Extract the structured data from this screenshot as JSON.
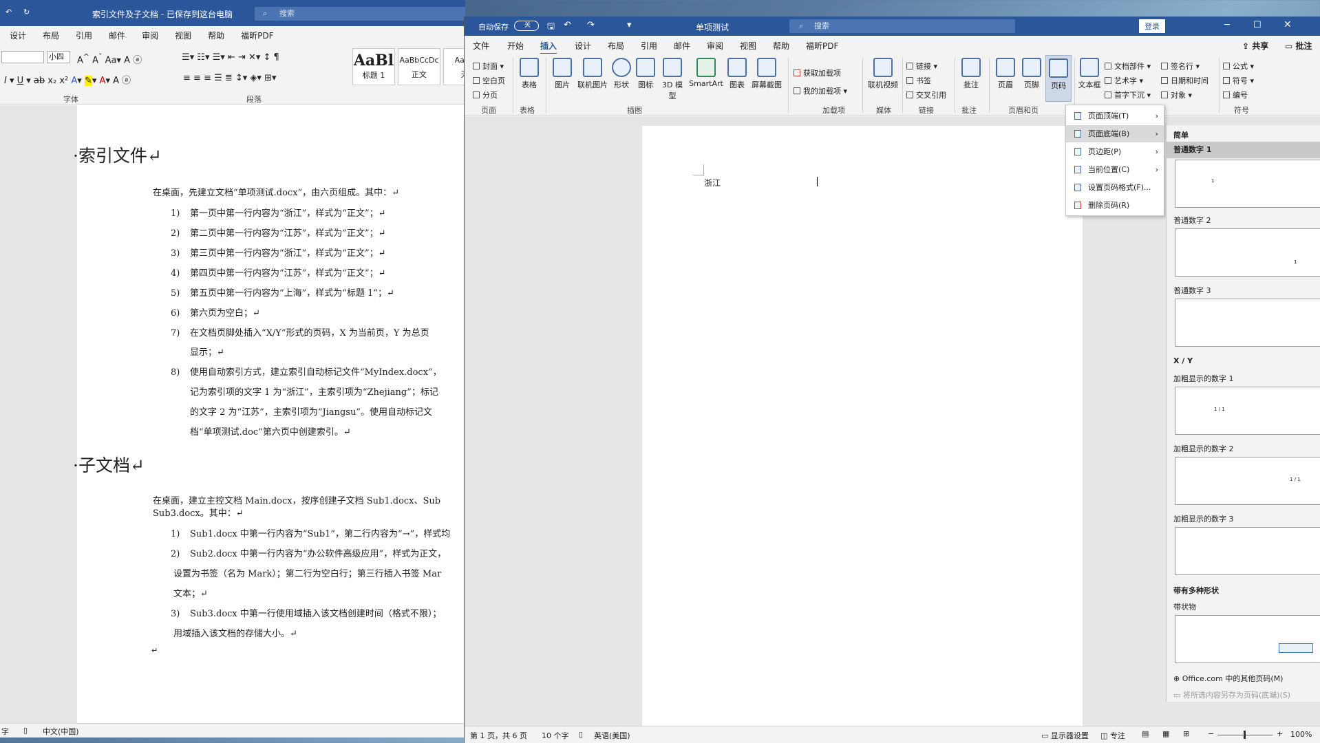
{
  "back_window": {
    "title": "索引文件及子文档 - 已保存到这台电脑",
    "search_placeholder": "搜索",
    "tabs": [
      "设计",
      "布局",
      "引用",
      "邮件",
      "审阅",
      "视图",
      "帮助",
      "福昕PDF"
    ],
    "font_size": "小四",
    "styles": [
      {
        "preview": "AaBl",
        "label": "标题 1"
      },
      {
        "preview": "AaBbCcDc",
        "label": "正文"
      },
      {
        "preview": "AaBb",
        "label": "无"
      }
    ],
    "groups": {
      "font": "字体",
      "paragraph": "段落"
    },
    "document": {
      "heading1": "索引文件",
      "intro": "在桌面，先建立文档“单项测试.docx”，由六页组成。其中：",
      "items": [
        {
          "n": "1)",
          "text": "第一页中第一行内容为“浙江”，样式为“正文”；"
        },
        {
          "n": "2)",
          "text": "第二页中第一行内容为“江苏”，样式为“正文”；"
        },
        {
          "n": "3)",
          "text": "第三页中第一行内容为“浙江”，样式为“正文”；"
        },
        {
          "n": "4)",
          "text": "第四页中第一行内容为“江苏”，样式为“正文”；"
        },
        {
          "n": "5)",
          "text": "第五页中第一行内容为“上海”，样式为“标题 1”；"
        },
        {
          "n": "6)",
          "text": "第六页为空白；"
        },
        {
          "n": "7)",
          "text": "在文档页脚处插入“X/Y”形式的页码，X 为当前页，Y 为总页"
        },
        {
          "n": "8)",
          "text": "使用自动索引方式，建立索引自动标记文件“MyIndex.docx”，"
        }
      ],
      "item7_cont": "显示；",
      "item8_cont": [
        "记为索引项的文字 1 为“浙江”，主索引项为“Zhejiang”；标记",
        "的文字 2 为“江苏”，主索引项为“Jiangsu”。使用自动标记文",
        "档“单项测试.doc”第六页中创建索引。"
      ],
      "heading2": "子文档",
      "intro2": [
        "在桌面，建立主控文档 Main.docx，按序创建子文档 Sub1.docx、Sub",
        "Sub3.docx。其中："
      ],
      "sub_items": [
        {
          "n": "1)",
          "text": "Sub1.docx 中第一行内容为“Sub1”，第二行内容为“→”，样式均"
        },
        {
          "n": "2)",
          "text": "Sub2.docx 中第一行内容为“办公软件高级应用”，样式为正文，"
        },
        {
          "n": "3)",
          "text": "Sub3.docx 中第一行使用域插入该文档创建时间（格式不限）；"
        }
      ],
      "sub2_cont": [
        "设置为书签（名为 Mark）；第二行为空白行；第三行插入书签 Mar",
        "文本；"
      ],
      "sub3_cont": "用域插入该文档的存储大小。"
    },
    "status": {
      "words": "字",
      "lang": "中文(中国)"
    }
  },
  "front_window": {
    "autosave": "自动保存",
    "toggle": "关",
    "title": "单项测试",
    "search_placeholder": "搜索",
    "login": "登录",
    "tabs": [
      "文件",
      "开始",
      "插入",
      "设计",
      "布局",
      "引用",
      "邮件",
      "审阅",
      "视图",
      "帮助",
      "福昕PDF"
    ],
    "active_tab": "插入",
    "share": "共享",
    "comments": "批注",
    "ribbon": {
      "page_group": {
        "items": [
          "封面",
          "空白页",
          "分页"
        ],
        "label": "页面"
      },
      "table": {
        "label": "表格",
        "group": "表格"
      },
      "illustrations": {
        "items": [
          "图片",
          "联机图片",
          "形状",
          "图标",
          "3D 模型",
          "SmartArt",
          "图表",
          "屏幕截图"
        ],
        "label": "插图"
      },
      "addins": {
        "items": [
          "获取加载项",
          "我的加载项"
        ],
        "label": "加载项"
      },
      "media": {
        "item": "联机视频",
        "label": "媒体"
      },
      "links": {
        "items": [
          "链接",
          "书签",
          "交叉引用"
        ],
        "label": "链接"
      },
      "comment": {
        "item": "批注",
        "label": "批注"
      },
      "header_footer": {
        "items": [
          "页眉",
          "页脚",
          "页码"
        ],
        "label": "页眉和页"
      },
      "text": {
        "items": [
          "文本框"
        ],
        "side": [
          "文档部件",
          "艺术字",
          "首字下沉"
        ],
        "side2": [
          "签名行",
          "日期和时间",
          "对象"
        ],
        "label": "文本"
      },
      "symbols": {
        "items": [
          "公式",
          "符号",
          "编号"
        ],
        "label": "符号"
      }
    },
    "page_text": "浙江",
    "status": {
      "page": "第 1 页，共 6 页",
      "words": "10 个字",
      "lang": "英语(美国)",
      "display": "显示器设置",
      "focus": "专注",
      "zoom": "100%"
    }
  },
  "page_number_menu": {
    "items": [
      {
        "label": "页面顶端(T)",
        "submenu": true
      },
      {
        "label": "页面底端(B)",
        "submenu": true
      },
      {
        "label": "页边距(P)",
        "submenu": true
      },
      {
        "label": "当前位置(C)",
        "submenu": true
      },
      {
        "label": "设置页码格式(F)...",
        "submenu": false
      },
      {
        "label": "删除页码(R)",
        "submenu": false
      }
    ],
    "active": "页面底端(B)"
  },
  "gallery": {
    "section_simple": "简单",
    "simple_items": [
      "普通数字 1",
      "普通数字 2",
      "普通数字 3"
    ],
    "section_xy": "X / Y",
    "xy_items": [
      "加粗显示的数字 1",
      "加粗显示的数字 2",
      "加粗显示的数字 3"
    ],
    "section_shapes": "带有多种形状",
    "shape_items": [
      "带状物"
    ],
    "thumb_texts": {
      "simple": "1",
      "xy": "1 / 1"
    },
    "more_link": "Office.com 中的其他页码(M)",
    "save_link": "将所选内容另存为页码(底端)(S)"
  }
}
